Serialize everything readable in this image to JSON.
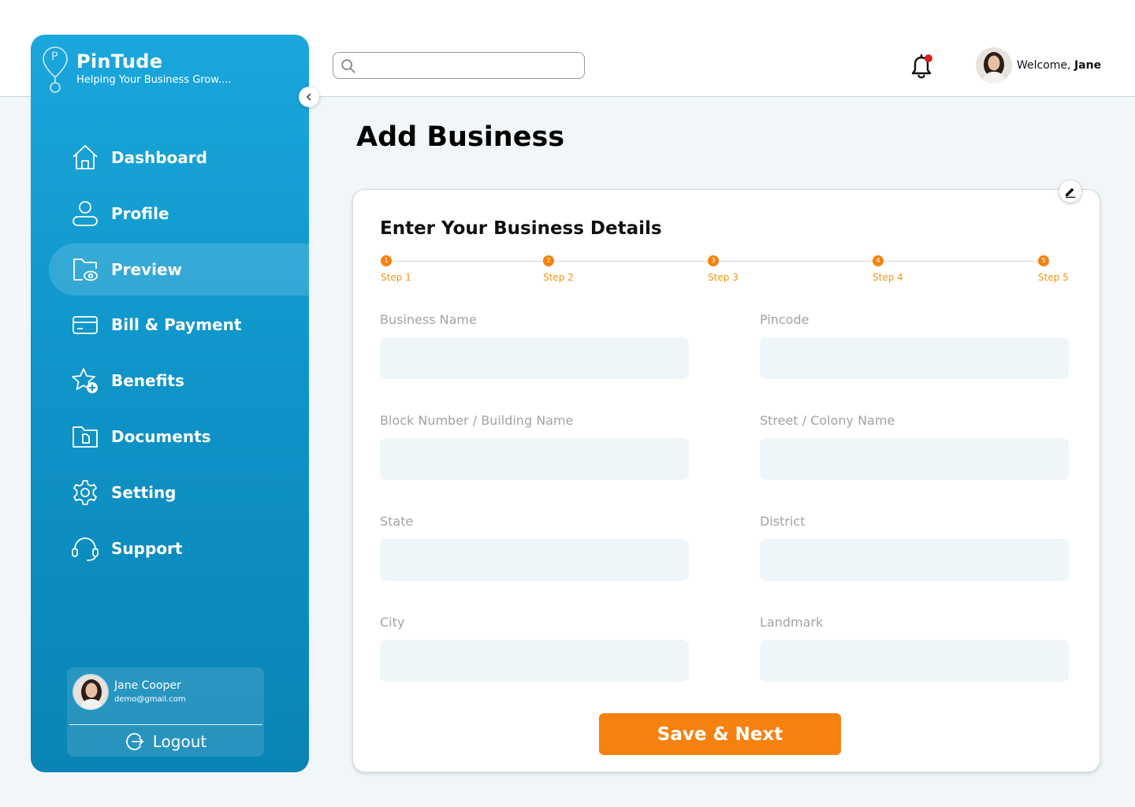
{
  "brand": {
    "name": "PinTude",
    "tagline": "Helping Your Business Grow....",
    "logo_letter": "P"
  },
  "header": {
    "search_placeholder": "",
    "welcome_prefix": "Welcome,",
    "user_first_name": "Jane",
    "notification_dot": true
  },
  "sidebar": {
    "items": [
      {
        "label": "Dashboard",
        "icon": "home-icon",
        "active": false
      },
      {
        "label": "Profile",
        "icon": "user-icon",
        "active": false
      },
      {
        "label": "Preview",
        "icon": "folder-eye-icon",
        "active": true
      },
      {
        "label": "Bill & Payment",
        "icon": "credit-card-icon",
        "active": false
      },
      {
        "label": "Benefits",
        "icon": "star-plus-icon",
        "active": false
      },
      {
        "label": "Documents",
        "icon": "document-folder-icon",
        "active": false
      },
      {
        "label": "Setting",
        "icon": "gear-icon",
        "active": false
      },
      {
        "label": "Support",
        "icon": "headset-icon",
        "active": false
      }
    ],
    "user": {
      "name": "Jane Cooper",
      "email": "demo@gmail.com"
    },
    "logout_label": "Logout"
  },
  "main": {
    "title": "Add Business",
    "card_title": "Enter Your Business Details",
    "steps": [
      {
        "number": "1",
        "label": "Step 1"
      },
      {
        "number": "2",
        "label": "Step 2"
      },
      {
        "number": "3",
        "label": "Step 3"
      },
      {
        "number": "4",
        "label": "Step 4"
      },
      {
        "number": "5",
        "label": "Step 5"
      }
    ],
    "fields": {
      "business_name": {
        "label": "Business Name",
        "value": ""
      },
      "pincode": {
        "label": "Pincode",
        "value": ""
      },
      "block_building": {
        "label": "Block Number / Building Name",
        "value": ""
      },
      "street_colony": {
        "label": "Street / Colony Name",
        "value": ""
      },
      "state": {
        "label": "State",
        "value": ""
      },
      "district": {
        "label": "District",
        "value": ""
      },
      "city": {
        "label": "City",
        "value": ""
      },
      "landmark": {
        "label": "Landmark",
        "value": ""
      }
    },
    "save_button": "Save & Next"
  },
  "colors": {
    "sidebar_top": "#1aa7dc",
    "sidebar_bottom": "#0a84b4",
    "accent": "#f5820f",
    "step_label": "#f5940f",
    "input_bg": "#eef6f9",
    "page_bg": "#f1f7f9"
  }
}
